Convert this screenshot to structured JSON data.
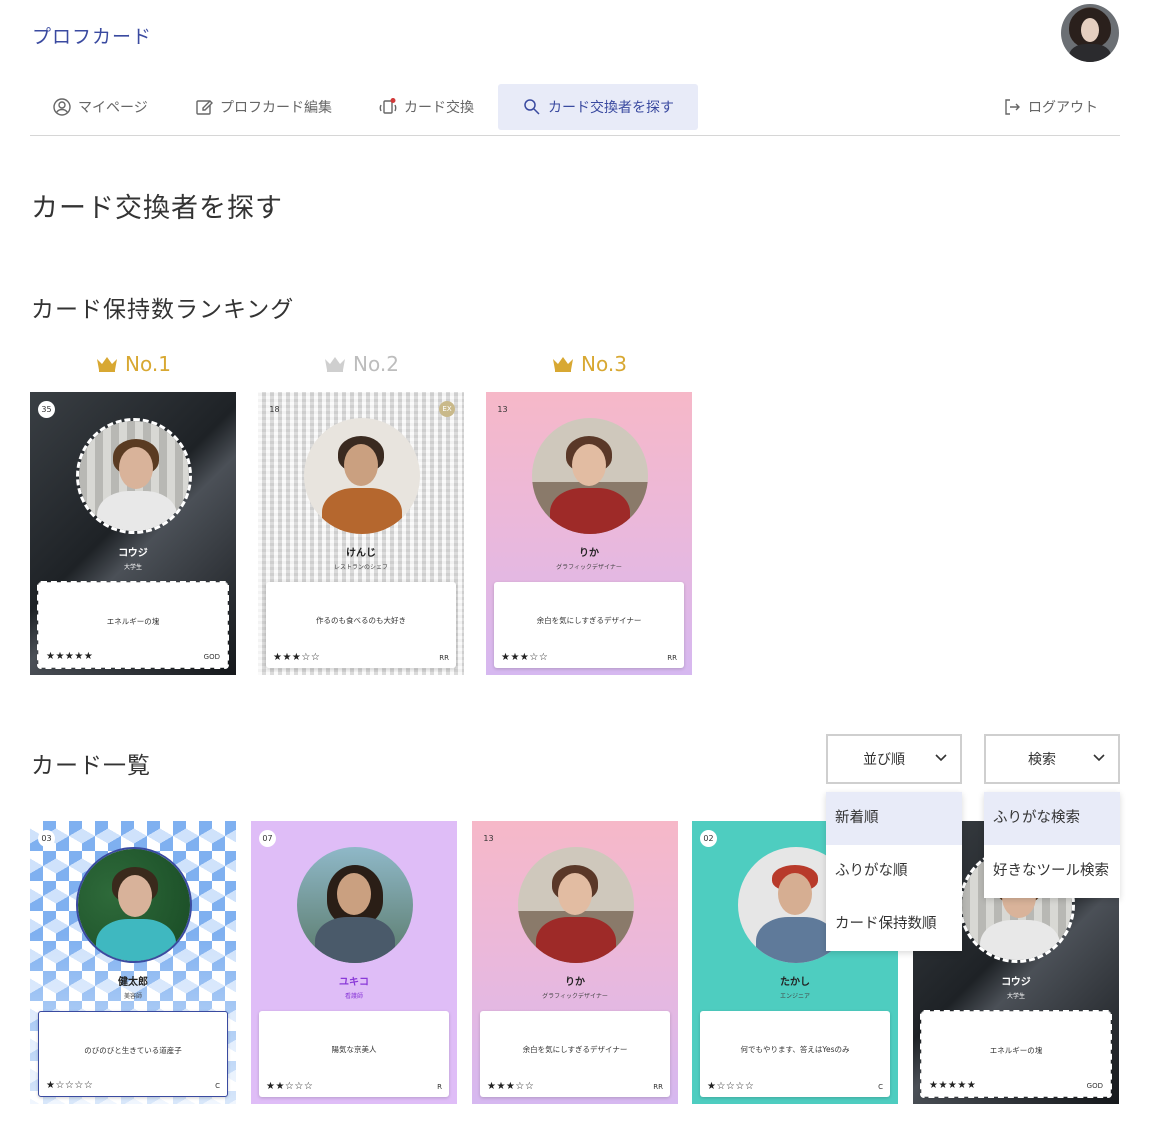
{
  "header": {
    "brand": "プロフカード"
  },
  "nav": {
    "items": [
      {
        "label": "マイページ"
      },
      {
        "label": "プロフカード編集"
      },
      {
        "label": "カード交換"
      },
      {
        "label": "カード交換者を探す"
      }
    ],
    "logout": "ログアウト"
  },
  "page_title": "カード交換者を探す",
  "ranking": {
    "title": "カード保持数ランキング",
    "labels": [
      "No.1",
      "No.2",
      "No.3"
    ],
    "colors": {
      "gold": "#d8a832",
      "silver": "#c8c8c8"
    },
    "cards": [
      {
        "num": "35",
        "name": "コウジ",
        "job": "大学生",
        "quote": "エネルギーの塊",
        "stars": "★★★★★",
        "rarity": "GOD"
      },
      {
        "num": "18",
        "badge": "EX",
        "name": "けんじ",
        "job": "レストランのシェフ",
        "quote": "作るのも食べるのも大好き",
        "stars": "★★★☆☆",
        "rarity": "RR"
      },
      {
        "num": "13",
        "name": "りか",
        "job": "グラフィックデザイナー",
        "quote": "余白を気にしすぎるデザイナー",
        "stars": "★★★☆☆",
        "rarity": "RR"
      }
    ]
  },
  "list": {
    "title": "カード一覧",
    "sort_label": "並び順",
    "search_label": "検索",
    "sort_options": [
      "新着順",
      "ふりがな順",
      "カード保持数順"
    ],
    "search_options": [
      "ふりがな検索",
      "好きなツール検索"
    ],
    "cards": [
      {
        "num": "03",
        "name": "健太郎",
        "job": "美容師",
        "quote": "のびのびと生きている道産子",
        "stars": "★☆☆☆☆",
        "rarity": "C"
      },
      {
        "num": "07",
        "name": "ユキコ",
        "job": "看護師",
        "quote": "陽気な京美人",
        "stars": "★★☆☆☆",
        "rarity": "R"
      },
      {
        "num": "13",
        "name": "りか",
        "job": "グラフィックデザイナー",
        "quote": "余白を気にしすぎるデザイナー",
        "stars": "★★★☆☆",
        "rarity": "RR"
      },
      {
        "num": "02",
        "name": "たかし",
        "job": "エンジニア",
        "quote": "何でもやります、答えはYesのみ",
        "stars": "★☆☆☆☆",
        "rarity": "C"
      },
      {
        "name": "コウジ",
        "job": "大学生",
        "quote": "エネルギーの塊",
        "stars": "★★★★★",
        "rarity": "GOD"
      }
    ]
  }
}
